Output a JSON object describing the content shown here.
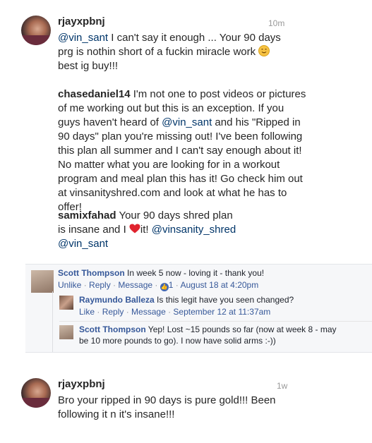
{
  "comment1": {
    "username": "rjayxpbnj",
    "time": "10m",
    "line1_mention": "@vin_sant",
    "line1_rest": " I can't say it enough ... Your 90 days",
    "line2": "prg is nothin short of a fuckin miracle work ",
    "line3": "best ig buy!!!"
  },
  "comment2": {
    "username": "chasedaniel14",
    "lines": [
      " I'm not one to post videos or pictures",
      "of me working out but this is an exception. If you",
      "guys haven't heard of ",
      "90 days\" plan you're missing out! I've been following",
      "this plan all summer and I can't say enough about it!",
      "No matter what you are looking for in a workout",
      "program and meal plan this has it! Go check him out",
      "at vinsanityshred.com and look at what he has to",
      "offer!"
    ],
    "mention": "@vin_sant",
    "line3_rest": " and his \"Ripped in"
  },
  "comment3": {
    "username": "samixfahad",
    "line1_rest": " Your 90 days shred plan",
    "line2_pre": "is insane and I ",
    "line2_post": "it! ",
    "line2_mention": "@vinsanity_shred",
    "line3_mention": "@vin_sant"
  },
  "fb": {
    "main": {
      "name": "Scott Thompson",
      "text": " In week 5 now - loving it - thank you!",
      "unlike": "Unlike",
      "reply": "Reply",
      "message": "Message",
      "likes": "1",
      "date": "August 18 at 4:20pm",
      "sep": " · "
    },
    "reply1": {
      "name": "Raymundo Balleza",
      "text": " Is this legit have you seen changed?",
      "like": "Like",
      "reply": "Reply",
      "message": "Message",
      "date": "September 12 at 11:37am"
    },
    "reply2": {
      "name": "Scott Thompson",
      "text1": " Yep! Lost ~15 pounds so far (now at week 8 - may",
      "text2": "be 10 more pounds to go). I now have solid arms :-))"
    }
  },
  "comment4": {
    "username": "rjayxpbnj",
    "time": "1w",
    "line1": "Bro your ripped in 90 days is pure gold!!! Been",
    "line2": "following it n it's insane!!!"
  },
  "colors": {
    "mention": "#003569",
    "fb_link": "#365899",
    "fb_panel": "#f6f7f9",
    "heart": "#e0232e",
    "smile": "#f6c243"
  },
  "icons": [
    "smile-emoji-icon",
    "heart-emoji-icon",
    "like-thumb-icon"
  ]
}
